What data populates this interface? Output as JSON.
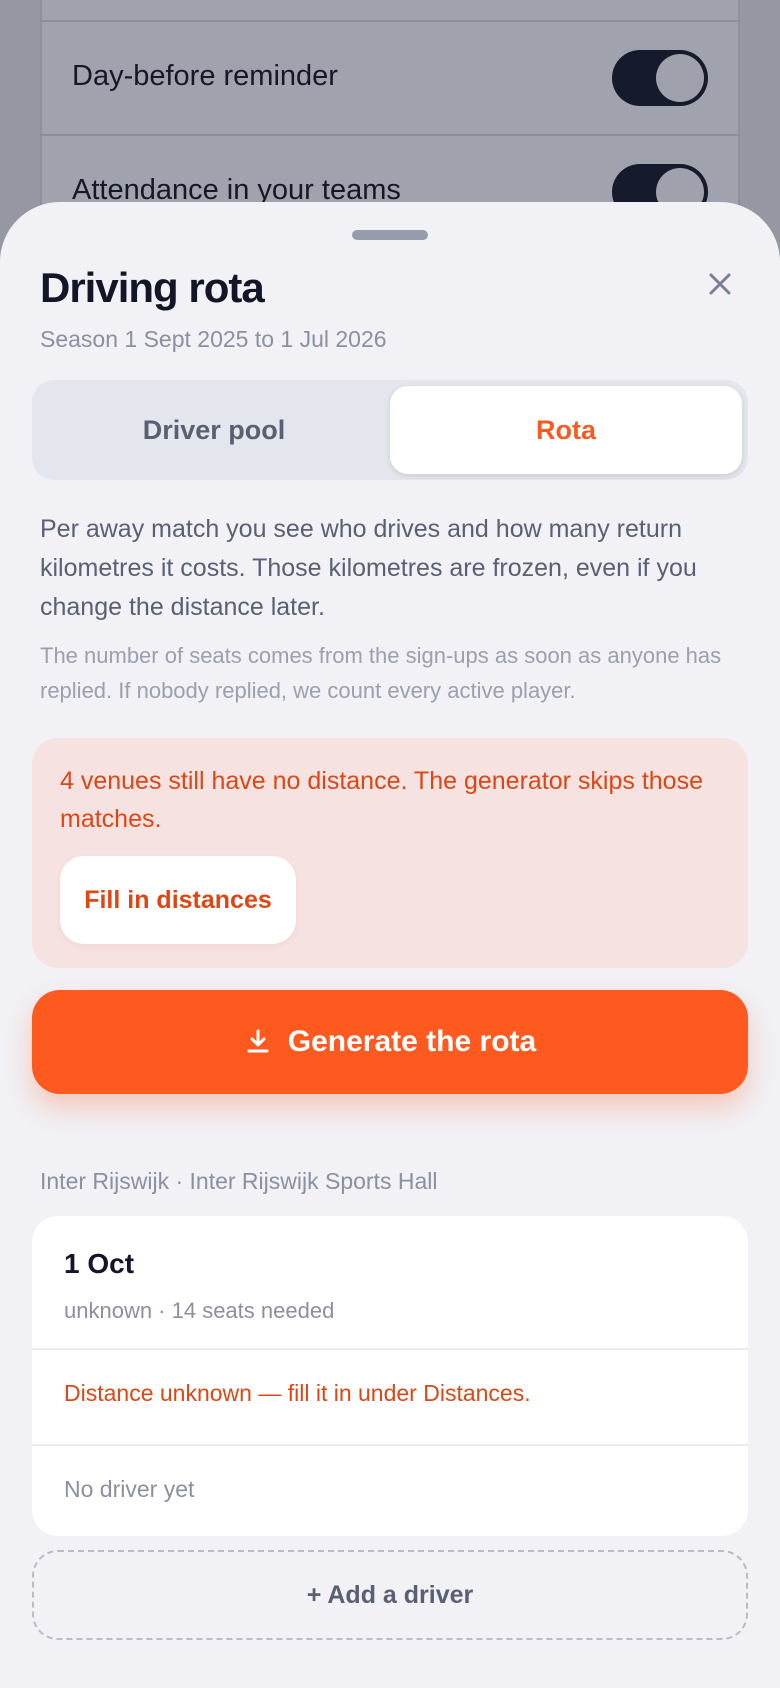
{
  "background": {
    "rows": [
      {
        "label": "Day-before reminder",
        "on": true
      },
      {
        "label": "Attendance in your teams",
        "on": true
      }
    ]
  },
  "sheet": {
    "title": "Driving rota",
    "subtitle": "Season 1 Sept 2025 to 1 Jul 2026",
    "close_icon": "close-icon",
    "tabs": [
      {
        "label": "Driver pool",
        "active": false
      },
      {
        "label": "Rota",
        "active": true
      }
    ],
    "description": "Per away match you see who drives and how many return kilometres it costs. Those kilometres are frozen, even if you change the distance later.",
    "note": "The number of seats comes from the sign-ups as soon as anyone has replied. If nobody replied, we count every active player.",
    "warning": {
      "text": "4 venues still have no distance. The generator skips those matches.",
      "button_label": "Fill in distances"
    },
    "primary_button": {
      "label": "Generate the rota",
      "icon": "download-icon"
    },
    "group_label": "Inter Rijswijk · Inter Rijswijk Sports Hall",
    "match": {
      "date": "1 Oct",
      "meta": "unknown · 14 seats needed",
      "distance_warning": "Distance unknown — fill it in under Distances.",
      "driver_status": "No driver yet"
    },
    "add_driver_label": "+ Add a driver"
  },
  "colors": {
    "accent": "#fe5a20",
    "warning_text": "#dc4715",
    "warning_bg": "#f6e2e1",
    "sheet_bg": "#f1f1f6"
  }
}
